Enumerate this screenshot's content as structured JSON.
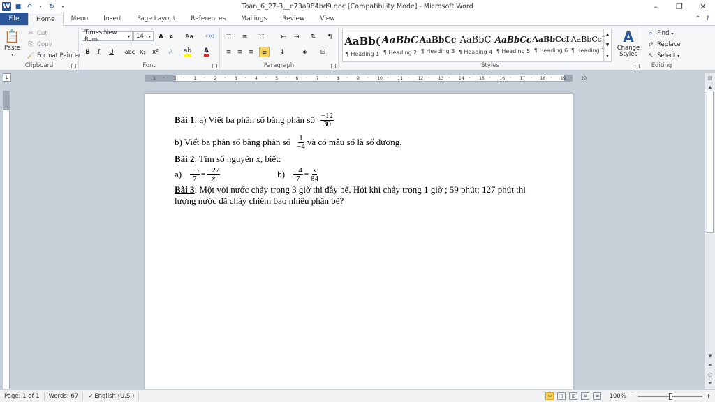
{
  "window": {
    "title": "Toan_6_27-3__e73a984bd9.doc [Compatibility Mode]  -  Microsoft Word",
    "minimize": "–",
    "maximize": "❐",
    "close": "✕"
  },
  "tabs": [
    "File",
    "Home",
    "Menu",
    "Insert",
    "Page Layout",
    "References",
    "Mailings",
    "Review",
    "View"
  ],
  "ribbon": {
    "clipboard": {
      "label": "Clipboard",
      "paste": "Paste",
      "cut": "Cut",
      "copy": "Copy",
      "format_painter": "Format Painter"
    },
    "font": {
      "label": "Font",
      "font_name": "Times New Rom",
      "font_size": "14",
      "grow": "A",
      "shrink": "A",
      "case": "Aa",
      "bold": "B",
      "italic": "I",
      "underline": "U",
      "strike": "abc",
      "subscript": "x₂",
      "superscript": "x²"
    },
    "paragraph": {
      "label": "Paragraph",
      "pilcrow": "¶"
    },
    "styles": {
      "label": "Styles",
      "change_styles": "Change Styles",
      "items": [
        {
          "sample": "AaBb(",
          "name": "¶ Heading 1"
        },
        {
          "sample": "AaBbC",
          "name": "¶ Heading 2"
        },
        {
          "sample": "AaBbCc",
          "name": "¶ Heading 3"
        },
        {
          "sample": "AaBbC",
          "name": "¶ Heading 4"
        },
        {
          "sample": "AaBbCc",
          "name": "¶ Heading 5"
        },
        {
          "sample": "AaBbCcI",
          "name": "¶ Heading 6"
        },
        {
          "sample": "AaBbCcI",
          "name": "¶ Heading 7"
        }
      ]
    },
    "editing": {
      "label": "Editing",
      "find": "Find",
      "replace": "Replace",
      "select": "Select"
    }
  },
  "ruler": {
    "ticks": [
      "1",
      "·",
      "1",
      "·",
      "1",
      "·",
      "2",
      "·",
      "3",
      "·",
      "4",
      "·",
      "5",
      "·",
      "6",
      "·",
      "7",
      "·",
      "8",
      "·",
      "9",
      "·",
      "10",
      "·",
      "11",
      "·",
      "12",
      "·",
      "13",
      "·",
      "14",
      "·",
      "15",
      "·",
      "16",
      "·",
      "17",
      "·",
      "18",
      "·",
      "19",
      "·",
      "20"
    ]
  },
  "document": {
    "bai1_label": "Bài 1",
    "bai1_text": ": a) Viết ba phân số bằng phân số",
    "bai1_frac_num": "−12",
    "bai1_frac_den": "30",
    "b_text1": "b) Viết ba phân số bằng phân số",
    "b_frac_num": "1",
    "b_frac_den": "−4",
    "b_text2": "và có mẫu số là số dương.",
    "bai2_label": "Bài 2",
    "bai2_text": ": Tìm số nguyên x, biết:",
    "a_label": "a)",
    "a_f1_num": "−3",
    "a_f1_den": "7",
    "a_eq": "=",
    "a_f2_num": "−27",
    "a_f2_den": "x",
    "bb_label": "b)",
    "bb_f1_num": "−4",
    "bb_f1_den": "7",
    "bb_eq": "=",
    "bb_f2_num": "x",
    "bb_f2_den": "84",
    "bai3_label": "Bài 3",
    "bai3_line1": ": Một vòi nước chảy trong 3 giờ thì đầy bể. Hỏi khi chảy trong 1 giờ ; 59 phút; 127 phút thì",
    "bai3_line2": "lượng nước đã chảy chiếm bao nhiêu phần bể?"
  },
  "status": {
    "page": "Page: 1 of 1",
    "words": "Words: 67",
    "language": "English (U.S.)",
    "zoom": "100%",
    "zoom_minus": "−",
    "zoom_plus": "+"
  }
}
